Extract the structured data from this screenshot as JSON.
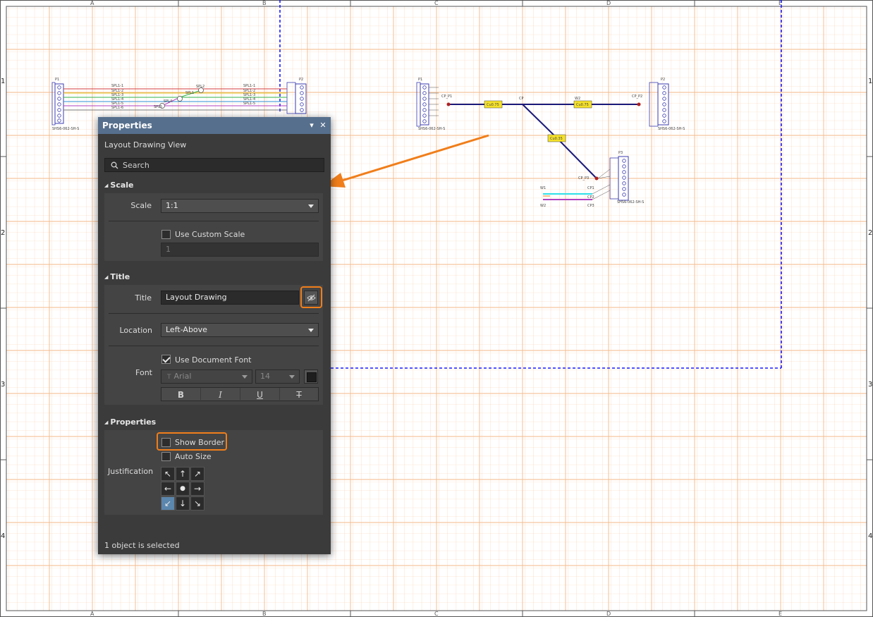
{
  "sheet": {
    "columns": [
      "A",
      "B",
      "C",
      "D",
      "E"
    ],
    "rows": [
      "1",
      "2",
      "3",
      "4"
    ]
  },
  "drawing_left": {
    "connectors": {
      "p1_name": "P1",
      "p2_name": "P2",
      "p1_part": "SHS6-062-SH-S",
      "p2_part": "SHS6-062-SH-S"
    },
    "wire_labels": [
      "SPL1-1",
      "SPL1-2",
      "SPL1-3",
      "SPL1-4",
      "SPL1-5",
      "SPL1-6"
    ],
    "splice_labels": [
      "SPL1",
      "SPL2",
      "SPL3",
      "SPL4",
      "SPL5"
    ],
    "colors": [
      "#d43f3f",
      "#32b34a",
      "#2f8fd6",
      "#b040c0",
      "#e2c21a",
      "#777777"
    ]
  },
  "drawing_right": {
    "labels": {
      "p1": "P1",
      "p2": "P2",
      "p3": "P3",
      "cp": "CP",
      "cp_p1": "CP_P1",
      "cp_p2": "CP_P2",
      "cp_p3": "CP_P3",
      "cp1": "CP1",
      "cp2": "CP2",
      "cp3": "CP3",
      "w1": "W1",
      "w2": "W2"
    },
    "bundle_labels": [
      "Cu0.75",
      "Cu0.75",
      "Cu0.35"
    ],
    "connector_part": "SHS6-062-SH-S",
    "colors": {
      "bundle": "#1a1a7a",
      "label_fill": "#f5e12a",
      "wire1": "#2ee0e8",
      "wire2": "#b040c0",
      "dash": "#1a1aff",
      "accent": "#f07e1a"
    }
  },
  "panel": {
    "title": "Properties",
    "menu_icon": "dropdown-arrow-icon",
    "close_icon": "close-icon",
    "subtitle": "Layout Drawing View",
    "search_placeholder": "Search",
    "scale_section": {
      "header": "Scale",
      "scale_label": "Scale",
      "scale_value": "1:1",
      "custom_scale_label": "Use Custom Scale",
      "custom_scale_checked": false,
      "custom_scale_value": "1"
    },
    "title_section": {
      "header": "Title",
      "title_label": "Title",
      "title_value": "Layout Drawing",
      "visibility_icon": "eye-off-icon",
      "location_label": "Location",
      "location_value": "Left-Above",
      "font_label": "Font",
      "use_doc_font_label": "Use Document Font",
      "use_doc_font_checked": true,
      "font_family": "Arial",
      "font_prefix": "T",
      "font_size": "14",
      "font_color": "#1e1e1e",
      "format_buttons": [
        "B",
        "I",
        "U",
        "T"
      ]
    },
    "properties_section": {
      "header": "Properties",
      "show_border_label": "Show Border",
      "show_border_checked": false,
      "auto_size_label": "Auto Size",
      "auto_size_checked": false,
      "justification_label": "Justification",
      "justification_arrows": [
        "↖",
        "↑",
        "↗",
        "←",
        "●",
        "→",
        "↙",
        "↓",
        "↘"
      ],
      "justification_selected": 6
    },
    "status": "1 object is selected"
  }
}
